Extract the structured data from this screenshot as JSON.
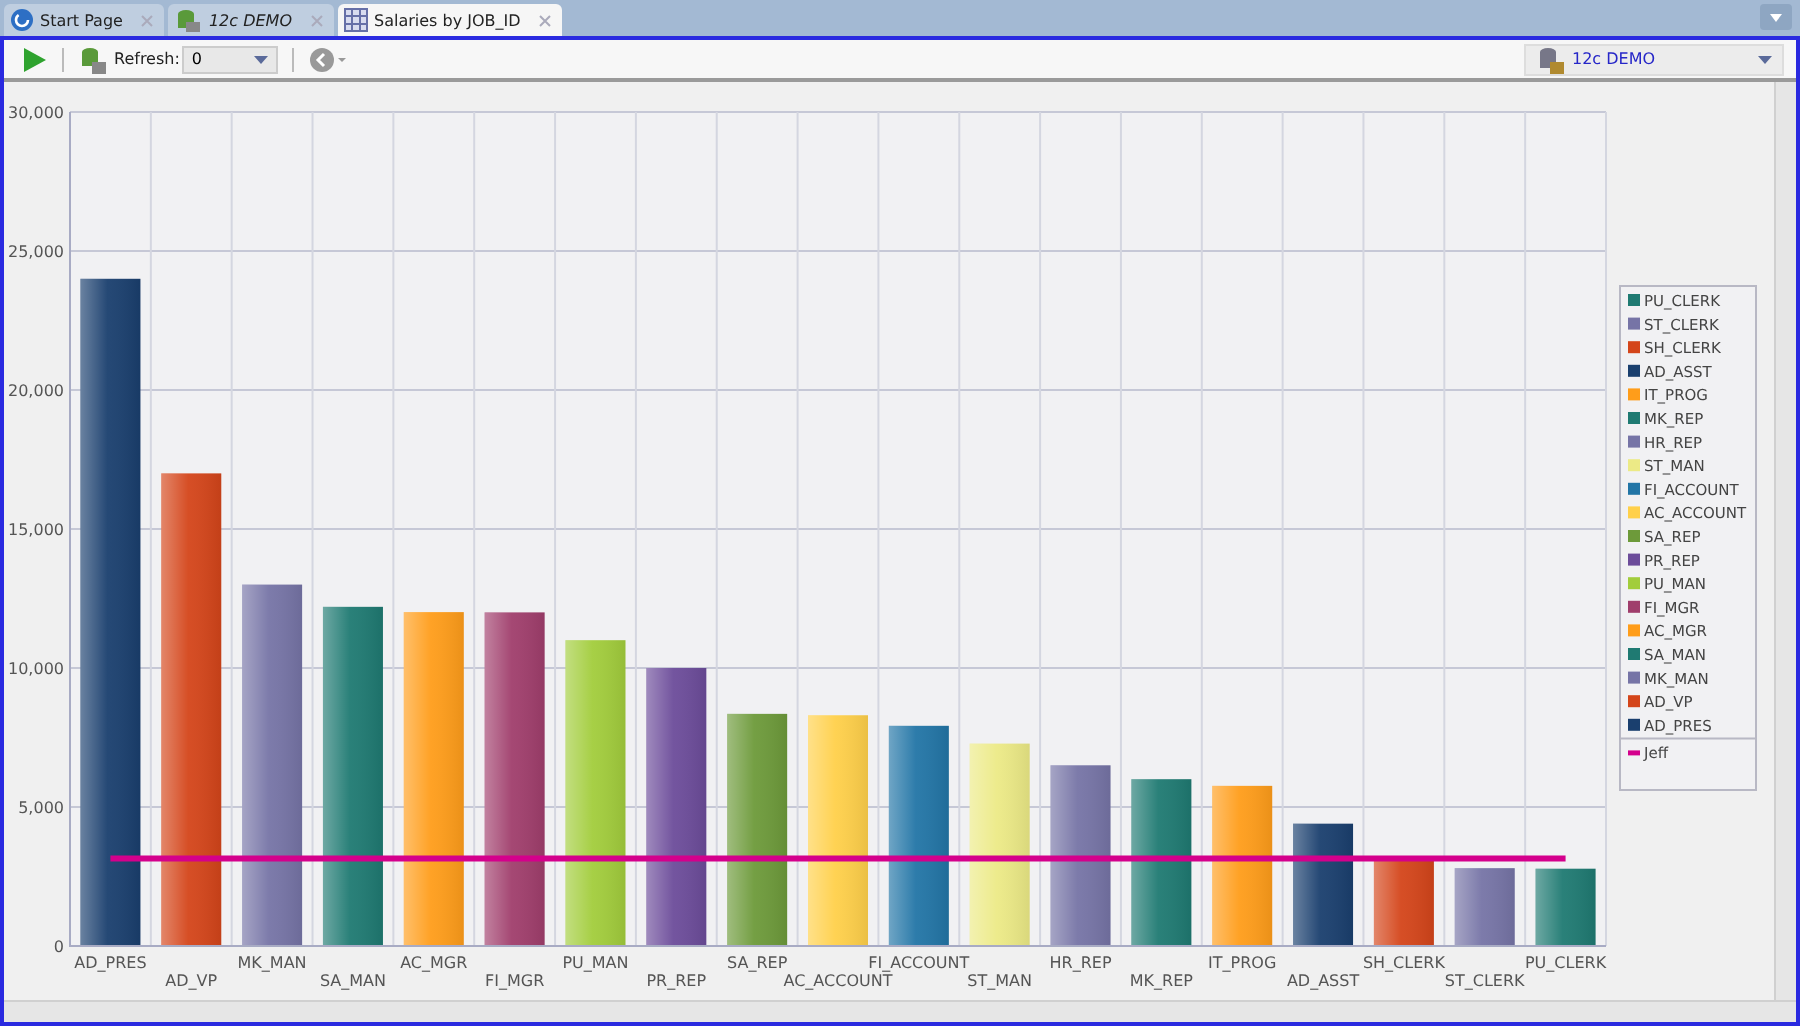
{
  "tabs": [
    {
      "label": "Start Page",
      "italic": false,
      "selected": false
    },
    {
      "label": "12c DEMO",
      "italic": true,
      "selected": false
    },
    {
      "label": "Salaries by JOB_ID",
      "italic": false,
      "selected": true
    }
  ],
  "toolbar": {
    "refresh_label": "Refresh:",
    "refresh_value": "0",
    "connection": "12c DEMO"
  },
  "chart": {
    "chart_data": {
      "type": "bar",
      "categories": [
        "AD_PRES",
        "AD_VP",
        "MK_MAN",
        "SA_MAN",
        "AC_MGR",
        "FI_MGR",
        "PU_MAN",
        "PR_REP",
        "SA_REP",
        "AC_ACCOUNT",
        "FI_ACCOUNT",
        "ST_MAN",
        "HR_REP",
        "MK_REP",
        "IT_PROG",
        "AD_ASST",
        "SH_CLERK",
        "ST_CLERK",
        "PU_CLERK"
      ],
      "ylim": [
        0,
        30000
      ],
      "grid": true,
      "legend": true,
      "yticks": [
        {
          "value": 0,
          "label": "0"
        },
        {
          "value": 5000,
          "label": "5,000"
        },
        {
          "value": 10000,
          "label": "10,000"
        },
        {
          "value": 15000,
          "label": "15,000"
        },
        {
          "value": 20000,
          "label": "20,000"
        },
        {
          "value": 25000,
          "label": "25,000"
        },
        {
          "value": 30000,
          "label": "30,000"
        }
      ],
      "series": [
        {
          "name": "PU_CLERK",
          "color": "#1f7a72",
          "values": [
            null,
            null,
            null,
            null,
            null,
            null,
            null,
            null,
            null,
            null,
            null,
            null,
            null,
            null,
            null,
            null,
            null,
            null,
            2780
          ]
        },
        {
          "name": "ST_CLERK",
          "color": "#7674a6",
          "values": [
            null,
            null,
            null,
            null,
            null,
            null,
            null,
            null,
            null,
            null,
            null,
            null,
            null,
            null,
            null,
            null,
            null,
            2800,
            null
          ]
        },
        {
          "name": "SH_CLERK",
          "color": "#d4451a",
          "values": [
            null,
            null,
            null,
            null,
            null,
            null,
            null,
            null,
            null,
            null,
            null,
            null,
            null,
            null,
            null,
            null,
            3200,
            null,
            null
          ]
        },
        {
          "name": "AD_ASST",
          "color": "#1a3f6e",
          "values": [
            null,
            null,
            null,
            null,
            null,
            null,
            null,
            null,
            null,
            null,
            null,
            null,
            null,
            null,
            null,
            4400,
            null,
            null,
            null
          ]
        },
        {
          "name": "IT_PROG",
          "color": "#ff9d1a",
          "values": [
            null,
            null,
            null,
            null,
            null,
            null,
            null,
            null,
            null,
            null,
            null,
            null,
            null,
            null,
            5760,
            null,
            null,
            null,
            null
          ]
        },
        {
          "name": "MK_REP",
          "color": "#1f7a72",
          "values": [
            null,
            null,
            null,
            null,
            null,
            null,
            null,
            null,
            null,
            null,
            null,
            null,
            null,
            6000,
            null,
            null,
            null,
            null,
            null
          ]
        },
        {
          "name": "HR_REP",
          "color": "#7674a6",
          "values": [
            null,
            null,
            null,
            null,
            null,
            null,
            null,
            null,
            null,
            null,
            null,
            null,
            6500,
            null,
            null,
            null,
            null,
            null,
            null
          ]
        },
        {
          "name": "ST_MAN",
          "color": "#ecea86",
          "values": [
            null,
            null,
            null,
            null,
            null,
            null,
            null,
            null,
            null,
            null,
            null,
            7280,
            null,
            null,
            null,
            null,
            null,
            null,
            null
          ]
        },
        {
          "name": "FI_ACCOUNT",
          "color": "#2275a6",
          "values": [
            null,
            null,
            null,
            null,
            null,
            null,
            null,
            null,
            null,
            null,
            7920,
            null,
            null,
            null,
            null,
            null,
            null,
            null,
            null
          ]
        },
        {
          "name": "AC_ACCOUNT",
          "color": "#ffd04a",
          "values": [
            null,
            null,
            null,
            null,
            null,
            null,
            null,
            null,
            null,
            8300,
            null,
            null,
            null,
            null,
            null,
            null,
            null,
            null,
            null
          ]
        },
        {
          "name": "SA_REP",
          "color": "#6d9a3a",
          "values": [
            null,
            null,
            null,
            null,
            null,
            null,
            null,
            null,
            8350,
            null,
            null,
            null,
            null,
            null,
            null,
            null,
            null,
            null,
            null
          ]
        },
        {
          "name": "PR_REP",
          "color": "#6c4c9a",
          "values": [
            null,
            null,
            null,
            null,
            null,
            null,
            null,
            10000,
            null,
            null,
            null,
            null,
            null,
            null,
            null,
            null,
            null,
            null,
            null
          ]
        },
        {
          "name": "PU_MAN",
          "color": "#a2cd3c",
          "values": [
            null,
            null,
            null,
            null,
            null,
            null,
            11000,
            null,
            null,
            null,
            null,
            null,
            null,
            null,
            null,
            null,
            null,
            null,
            null
          ]
        },
        {
          "name": "FI_MGR",
          "color": "#a03e6c",
          "values": [
            null,
            null,
            null,
            null,
            null,
            12000,
            null,
            null,
            null,
            null,
            null,
            null,
            null,
            null,
            null,
            null,
            null,
            null,
            null
          ]
        },
        {
          "name": "AC_MGR",
          "color": "#ff9d1a",
          "values": [
            null,
            null,
            null,
            null,
            12010,
            null,
            null,
            null,
            null,
            null,
            null,
            null,
            null,
            null,
            null,
            null,
            null,
            null,
            null
          ]
        },
        {
          "name": "SA_MAN",
          "color": "#1f7a72",
          "values": [
            null,
            null,
            null,
            12200,
            null,
            null,
            null,
            null,
            null,
            null,
            null,
            null,
            null,
            null,
            null,
            null,
            null,
            null,
            null
          ]
        },
        {
          "name": "MK_MAN",
          "color": "#7674a6",
          "values": [
            null,
            null,
            13000,
            null,
            null,
            null,
            null,
            null,
            null,
            null,
            null,
            null,
            null,
            null,
            null,
            null,
            null,
            null,
            null
          ]
        },
        {
          "name": "AD_VP",
          "color": "#d4451a",
          "values": [
            null,
            17000,
            null,
            null,
            null,
            null,
            null,
            null,
            null,
            null,
            null,
            null,
            null,
            null,
            null,
            null,
            null,
            null,
            null
          ]
        },
        {
          "name": "AD_PRES",
          "color": "#1a3f6e",
          "values": [
            24000,
            null,
            null,
            null,
            null,
            null,
            null,
            null,
            null,
            null,
            null,
            null,
            null,
            null,
            null,
            null,
            null,
            null,
            null
          ]
        },
        {
          "name": "Jeff",
          "type": "line",
          "color": "#d4008c",
          "values": [
            3150,
            3150,
            3150,
            3150,
            3150,
            3150,
            3150,
            3150,
            3150,
            3150,
            3150,
            3150,
            3150,
            3150,
            3150,
            3150,
            3150,
            3150,
            3150
          ]
        }
      ]
    }
  }
}
